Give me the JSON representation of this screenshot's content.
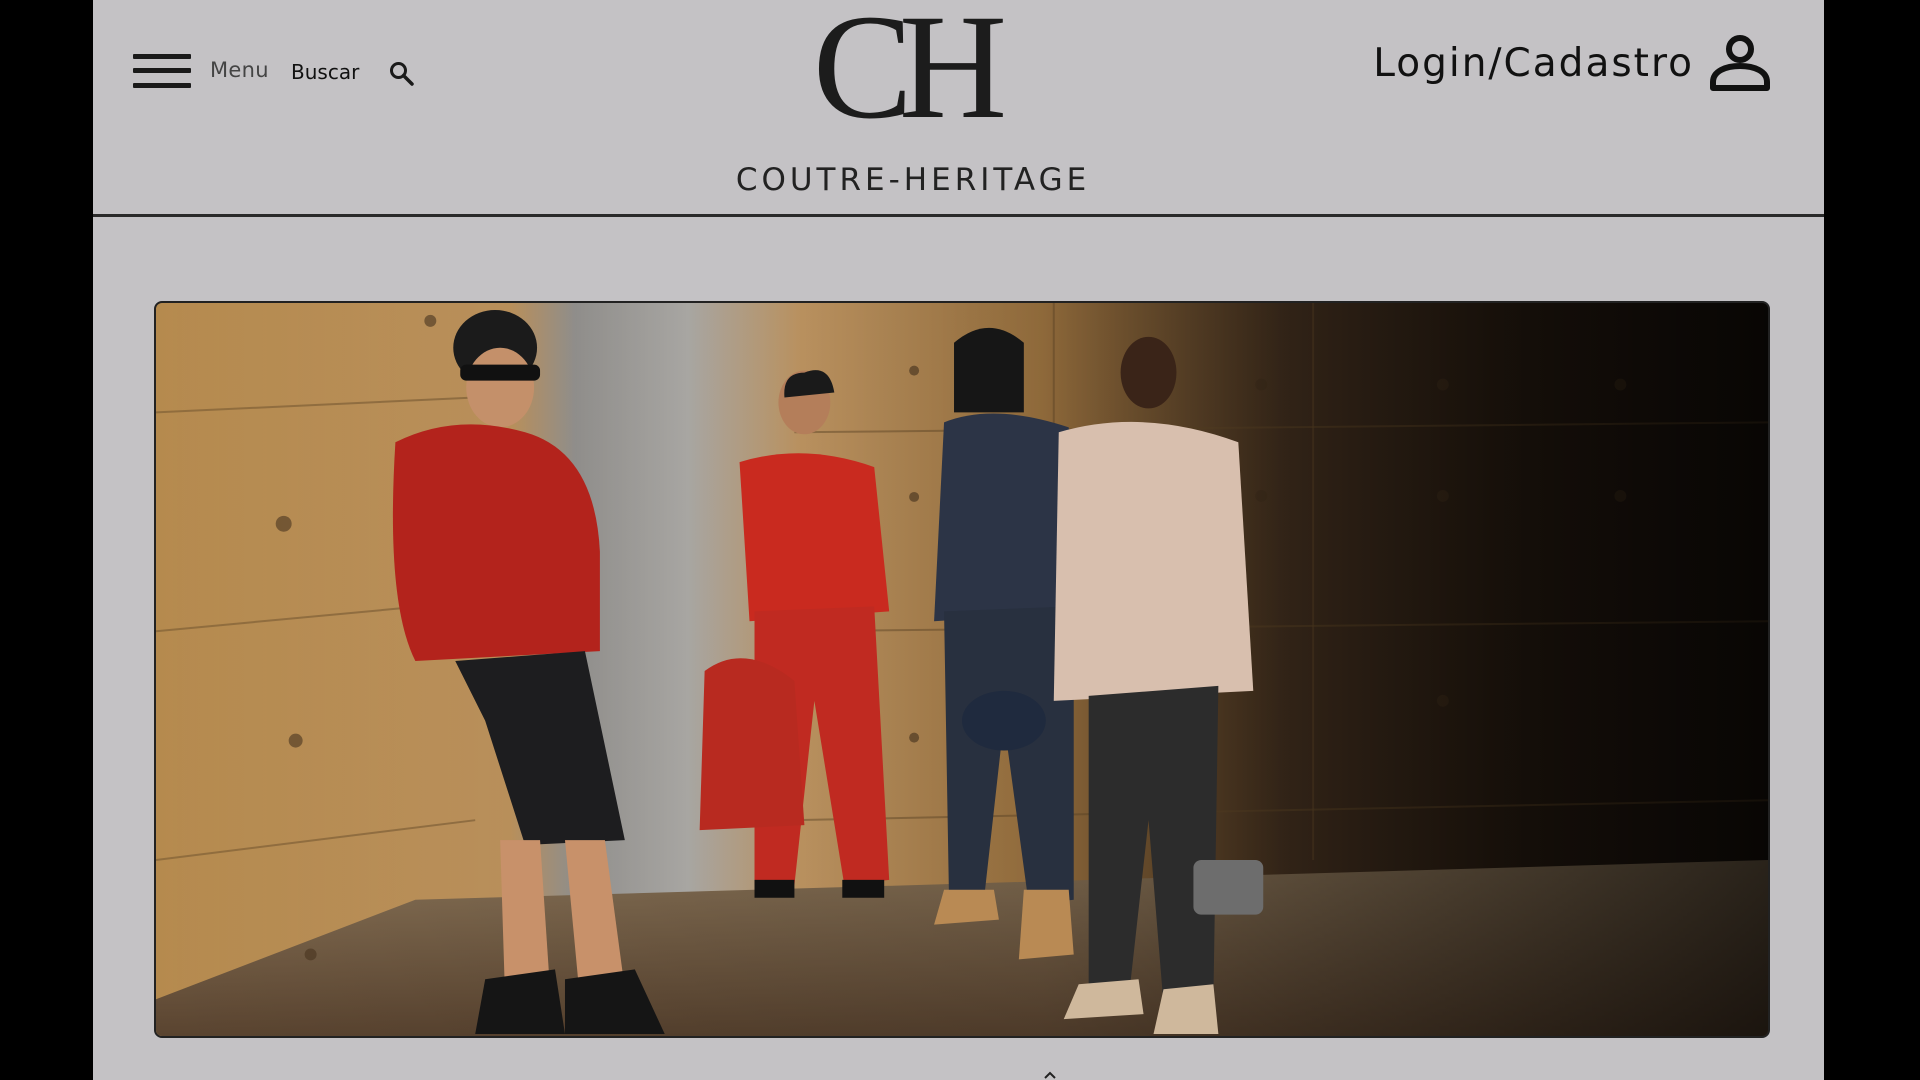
{
  "header": {
    "menu_label": "Menu",
    "search_label": "Buscar",
    "logo_mark": "CH",
    "logo_name": "COUTRE-HERITAGE",
    "login_label": "Login/Cadastro"
  },
  "icons": {
    "menu": "hamburger-icon",
    "search": "search-icon",
    "user": "user-icon"
  },
  "hero": {
    "image_subject": "fashion-campaign-photo"
  },
  "colors": {
    "page_bg": "#c4c2c5",
    "outer_bg": "#000000",
    "text": "#111111"
  }
}
